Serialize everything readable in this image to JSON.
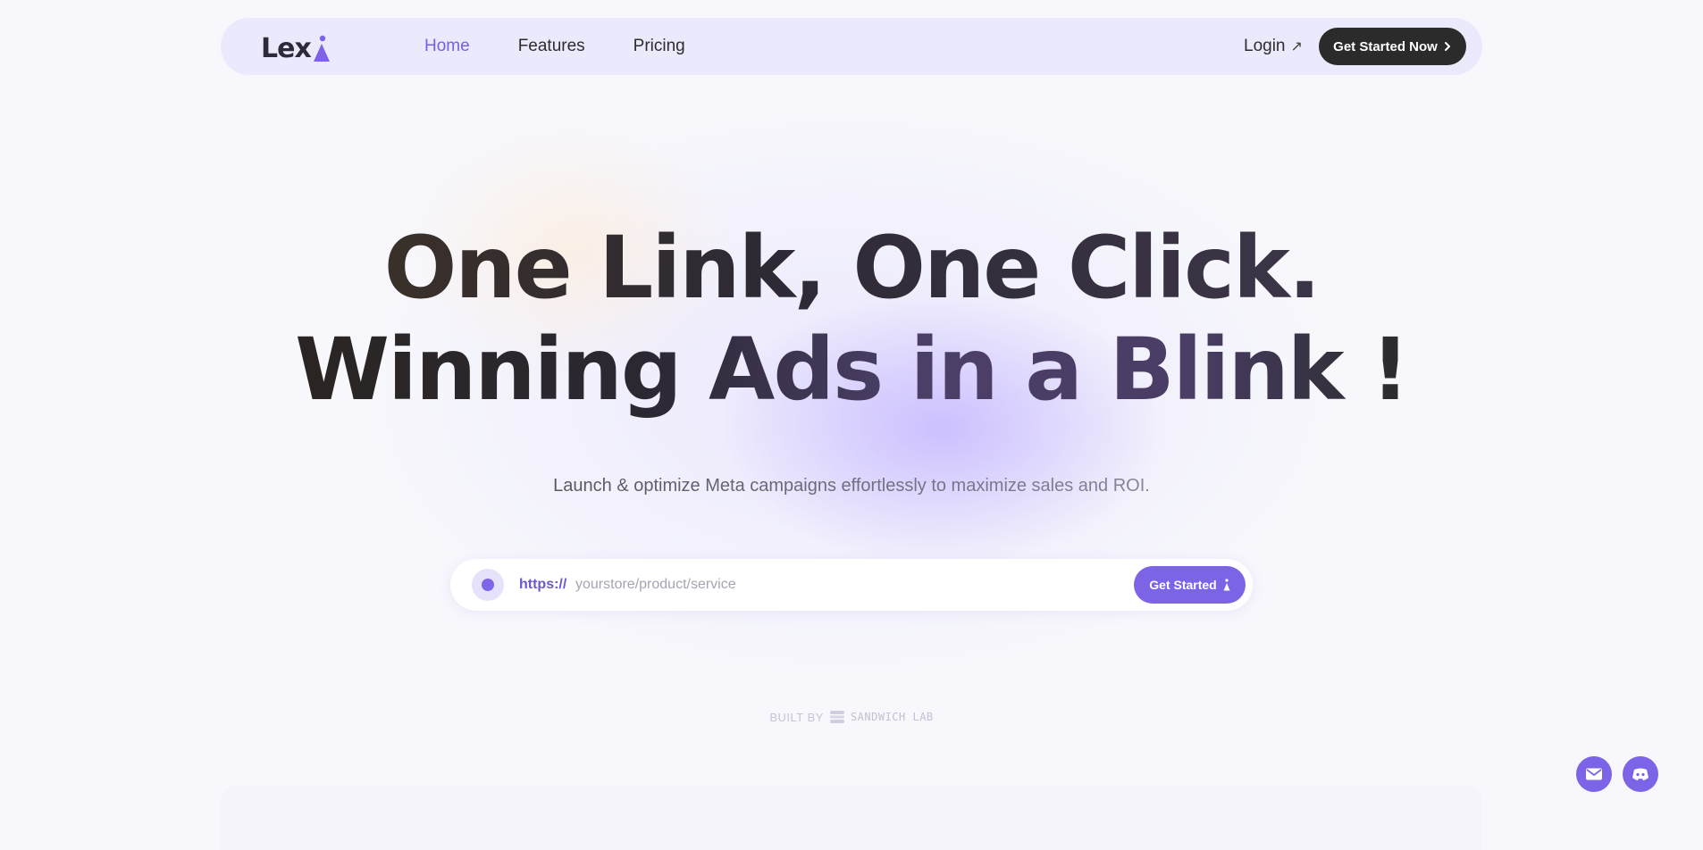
{
  "brand": {
    "logo_text": "Lex"
  },
  "nav": {
    "links": [
      {
        "label": "Home",
        "active": true
      },
      {
        "label": "Features",
        "active": false
      },
      {
        "label": "Pricing",
        "active": false
      }
    ],
    "login_label": "Login",
    "cta_label": "Get Started Now"
  },
  "hero": {
    "line1": "One Link, One Click.",
    "line2": "Winning Ads in a Blink !",
    "subtitle": "Launch & optimize Meta campaigns effortlessly to maximize sales and ROI."
  },
  "url_form": {
    "prefix": "https://",
    "placeholder": "yourstore/product/service",
    "button_label": "Get Started"
  },
  "footer": {
    "built_by_label": "BUILT BY",
    "built_by_brand": "SANDWICH LAB"
  },
  "colors": {
    "accent": "#7d63e6",
    "nav_bg": "#ebe9fc",
    "dark_button": "#2b2b2b",
    "page_bg": "#f7f7fc"
  }
}
